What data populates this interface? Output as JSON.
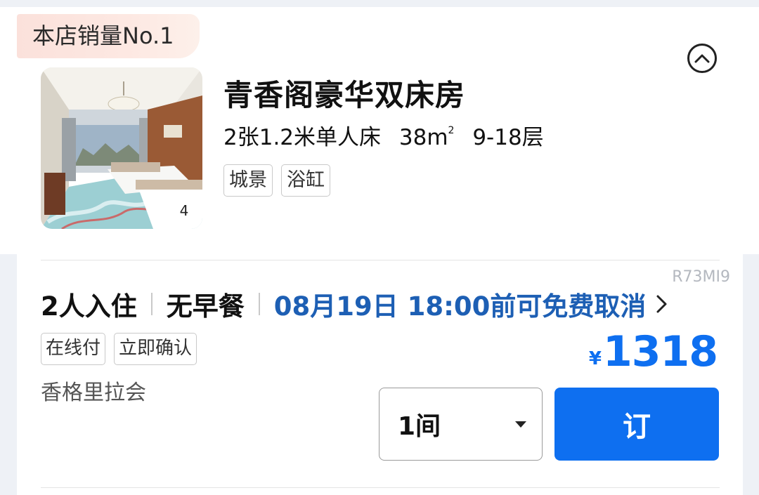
{
  "room": {
    "sales_badge": "本店销量No.1",
    "name": "青香阁豪华双床房",
    "specs": {
      "bed": "2张1.2米单人床",
      "area": "38m",
      "area_unit_sup": "2",
      "floors": "9-18层"
    },
    "tags": [
      "城景",
      "浴缸"
    ],
    "photo_count": "4",
    "collapse_icon": "chevron-up-circle-icon"
  },
  "rate": {
    "code": "R73MI9",
    "occupancy": "2人入住",
    "meal": "无早餐",
    "cancel_policy": "08月19日 18:00前可免费取消",
    "badges": [
      "在线付",
      "立即确认"
    ],
    "brand": "香格里拉会",
    "price": {
      "currency": "¥",
      "amount": "1318"
    },
    "room_count_select": "1间",
    "book_label": "订"
  },
  "colors": {
    "accent_blue": "#0e6ff0",
    "cancel_blue": "#1d5fb4",
    "badge_bg": "#fbe1db"
  }
}
